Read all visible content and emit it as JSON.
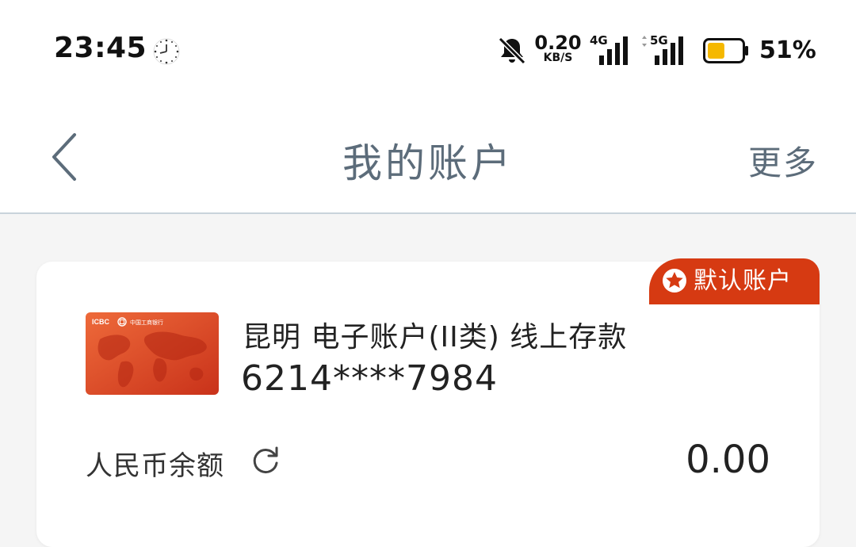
{
  "status_bar": {
    "time": "23:45",
    "net_speed_value": "0.20",
    "net_speed_unit": "KB/S",
    "signal_1_label": "4G",
    "signal_2_label": "5G",
    "battery_percent": "51%",
    "battery_level": 0.51,
    "battery_color": "#f5b800",
    "icons": [
      "clock-icon",
      "mute-bell-icon",
      "signal-icon",
      "signal-icon",
      "battery-icon"
    ]
  },
  "header": {
    "back_icon": "chevron-left-icon",
    "title": "我的账户",
    "more_label": "更多"
  },
  "account": {
    "default_badge": "默认账户",
    "badge_icon": "star-icon",
    "card_brand": "ICBC",
    "card_bank_name": "中国工商银行",
    "name": "昆明 电子账户(II类) 线上存款",
    "number": "6214****7984",
    "balance_label": "人民币余额",
    "refresh_icon": "refresh-icon",
    "balance": "0.00"
  },
  "colors": {
    "accent_red": "#d63a12",
    "card_orange": "#e6542a",
    "header_text": "#5c6c7a"
  }
}
